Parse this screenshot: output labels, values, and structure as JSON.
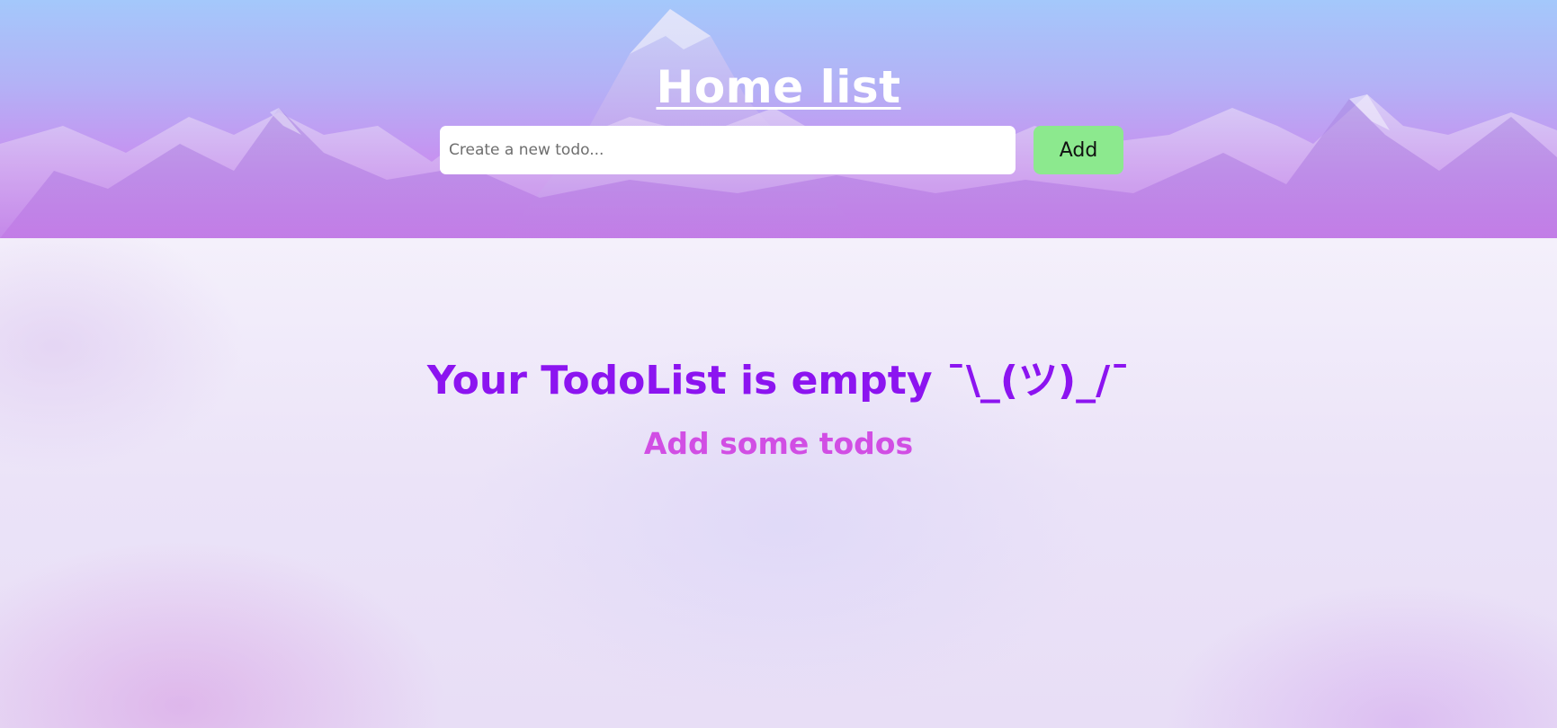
{
  "header": {
    "title": "Home list",
    "input_placeholder": "Create a new todo...",
    "input_value": "",
    "add_button_label": "Add"
  },
  "empty_state": {
    "title": "Your TodoList is empty ¯\\_(ツ)_/¯",
    "subtitle": "Add some todos"
  },
  "colors": {
    "title_color": "#ffffff",
    "add_button_bg": "#8ce98e",
    "empty_title_color": "#8c14f0",
    "empty_subtitle_color": "#d14ee4"
  }
}
